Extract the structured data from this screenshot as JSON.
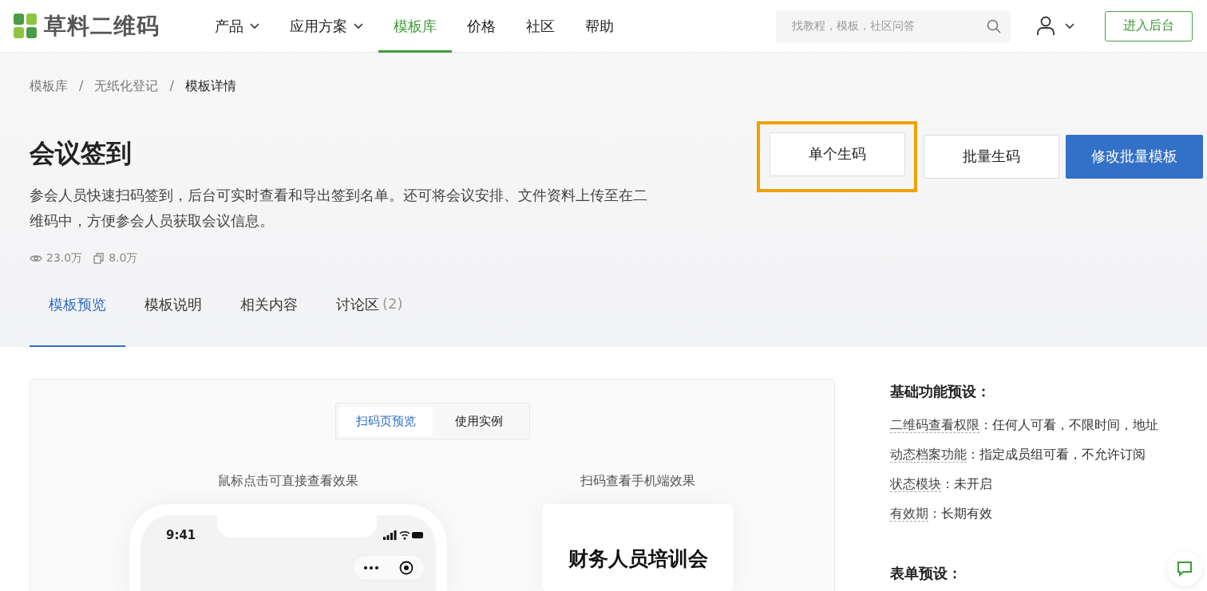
{
  "header": {
    "logo_text": "草料二维码",
    "nav": [
      {
        "label": "产品",
        "has_dropdown": true,
        "selected": false
      },
      {
        "label": "应用方案",
        "has_dropdown": true,
        "selected": false
      },
      {
        "label": "模板库",
        "has_dropdown": false,
        "selected": true
      },
      {
        "label": "价格",
        "has_dropdown": false,
        "selected": false
      },
      {
        "label": "社区",
        "has_dropdown": false,
        "selected": false
      },
      {
        "label": "帮助",
        "has_dropdown": false,
        "selected": false
      }
    ],
    "search": {
      "placeholder": "找教程，模板，社区问答"
    },
    "console_button": "进入后台"
  },
  "breadcrumb": [
    {
      "label": "模板库",
      "current": false
    },
    {
      "label": "/",
      "current": false
    },
    {
      "label": "无纸化登记",
      "current": false
    },
    {
      "label": "/",
      "current": false
    },
    {
      "label": "模板详情",
      "current": true
    }
  ],
  "template": {
    "title": "会议签到",
    "description": "参会人员快速扫码签到，后台可实时查看和导出签到名单。还可将会议安排、文件资料上传至在二维码中，方便参会人员获取会议信息。",
    "stats": [
      {
        "kind": "views",
        "value": "23.0万"
      },
      {
        "kind": "copies",
        "value": "8.0万"
      }
    ]
  },
  "actions": [
    {
      "label": "单个生码",
      "kind": "secondary",
      "highlighted": true
    },
    {
      "label": "批量生码",
      "kind": "secondary",
      "highlighted": false
    },
    {
      "label": "修改批量模板",
      "kind": "primary",
      "highlighted": false
    }
  ],
  "tabs": [
    {
      "label": "模板预览",
      "selected": true
    },
    {
      "label": "模板说明",
      "selected": false
    },
    {
      "label": "相关内容",
      "selected": false
    },
    {
      "label": "讨论区",
      "count": "(2)",
      "selected": false
    }
  ],
  "preview": {
    "modes": [
      {
        "label": "扫码页预览",
        "selected": true
      },
      {
        "label": "使用实例",
        "selected": false
      }
    ],
    "columns": [
      {
        "kind": "phone",
        "caption": "鼠标点击可直接查看效果",
        "time": "9:41"
      },
      {
        "kind": "qr_card",
        "caption": "扫码查看手机端效果",
        "title": "财务人员培训会"
      }
    ]
  },
  "settings": {
    "heading": "基础功能预设：",
    "items": [
      {
        "label": "二维码查看权限",
        "value": "：任何人可看，不限时间，地址"
      },
      {
        "label": "动态档案功能",
        "value": "：指定成员组可看，不允许订阅"
      },
      {
        "label": "状态模块",
        "value": "：未开启"
      },
      {
        "label": "有效期",
        "value": "：长期有效"
      }
    ]
  },
  "form_settings": {
    "heading": "表单预设："
  }
}
